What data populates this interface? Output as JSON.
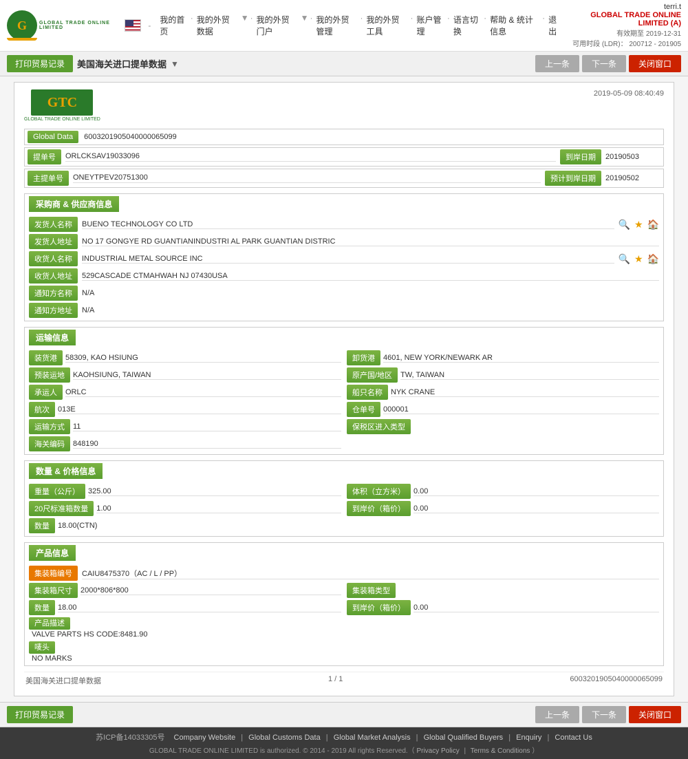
{
  "header": {
    "user": "terri.t",
    "company_name": "GLOBAL TRADE ONLINE LIMITED (A)",
    "valid_until_label": "有效期至",
    "valid_until": "2019-12-31",
    "ldr_label": "可用时段 (LDR)：",
    "ldr_value": "200712 - 201905"
  },
  "nav": {
    "home": "我的首页",
    "import_data": "我的外贸数据",
    "export_portal": "我的外贸门户",
    "foreign_mgmt": "我的外贸管理",
    "foreign_tools": "我的外贸工具",
    "account_mgmt": "账户管理",
    "language": "语言切换",
    "help": "帮助 & 统计信息",
    "logout": "退出"
  },
  "title": "美国海关进口提单数据",
  "buttons": {
    "print_trade": "打印贸易记录",
    "prev": "上一条",
    "next": "下一条",
    "close": "关闭窗口"
  },
  "doc": {
    "timestamp": "2019-05-09 08:40:49",
    "global_data_label": "Global Data",
    "global_data_value": "6003201905040000065099",
    "bill_no_label": "提单号",
    "bill_no_value": "ORLCKSAV19033096",
    "arrival_date_label": "到岸日期",
    "arrival_date_value": "20190503",
    "master_bill_label": "主提单号",
    "master_bill_value": "ONEYTPEV20751300",
    "est_arrival_label": "预计到岸日期",
    "est_arrival_value": "20190502"
  },
  "shipper_section": {
    "title": "采购商 & 供应商信息",
    "shipper_name_label": "发货人名称",
    "shipper_name_value": "BUENO TECHNOLOGY CO LTD",
    "shipper_addr_label": "发货人地址",
    "shipper_addr_value": "NO 17 GONGYE RD GUANTIANINDUSTRI AL PARK GUANTIAN DISTRIC",
    "consignee_name_label": "收货人名称",
    "consignee_name_value": "INDUSTRIAL METAL SOURCE INC",
    "consignee_addr_label": "收货人地址",
    "consignee_addr_value": "529CASCADE CTMAHWAH NJ 07430USA",
    "notify_name_label": "通知方名称",
    "notify_name_value": "N/A",
    "notify_addr_label": "通知方地址",
    "notify_addr_value": "N/A"
  },
  "transport_section": {
    "title": "运输信息",
    "loading_port_label": "装货港",
    "loading_port_value": "58309, KAO HSIUNG",
    "unloading_port_label": "卸货港",
    "unloading_port_value": "4601, NEW YORK/NEWARK AR",
    "pre_loading_label": "预装运地",
    "pre_loading_value": "KAOHSIUNG, TAIWAN",
    "origin_country_label": "原产国/地区",
    "origin_country_value": "TW, TAIWAN",
    "carrier_label": "承运人",
    "carrier_value": "ORLC",
    "vessel_label": "船只名称",
    "vessel_value": "NYK CRANE",
    "voyage_label": "航次",
    "voyage_value": "013E",
    "warehouse_label": "仓单号",
    "warehouse_value": "000001",
    "transport_mode_label": "运输方式",
    "transport_mode_value": "11",
    "bonded_zone_label": "保税区进入类型",
    "bonded_zone_value": "",
    "customs_code_label": "海关编码",
    "customs_code_value": "848190"
  },
  "quantity_section": {
    "title": "数量 & 价格信息",
    "weight_label": "重量（公斤）",
    "weight_value": "325.00",
    "volume_label": "体积（立方米）",
    "volume_value": "0.00",
    "container_20_label": "20尺标准箱数量",
    "container_20_value": "1.00",
    "arrival_price_label": "到岸价（箱价）",
    "arrival_price_value": "0.00",
    "quantity_label": "数量",
    "quantity_value": "18.00(CTN)"
  },
  "product_section": {
    "title": "产品信息",
    "container_no_label": "集装箱编号",
    "container_no_value": "CAIU8475370（AC / L / PP）",
    "container_size_label": "集装箱尺寸",
    "container_size_value": "2000*806*800",
    "container_type_label": "集装箱类型",
    "container_type_value": "",
    "quantity_label": "数量",
    "quantity_value": "18.00",
    "arrival_price_label": "到岸价（箱价）",
    "arrival_price_value": "0.00",
    "description_label": "产品描述",
    "description_value": "VALVE PARTS HS CODE:8481.90",
    "marks_label": "唛头",
    "marks_value": "NO MARKS"
  },
  "page_footer": {
    "source": "美国海关进口提单数据",
    "page": "1 / 1",
    "record_id": "6003201905040000065099"
  },
  "footer": {
    "icp": "苏ICP备14033305号",
    "links": [
      "Company Website",
      "Global Customs Data",
      "Global Market Analysis",
      "Global Qualified Buyers",
      "Enquiry",
      "Contact Us"
    ],
    "copyright": "GLOBAL TRADE ONLINE LIMITED is authorized. © 2014 - 2019 All rights Reserved.（",
    "privacy": "Privacy Policy",
    "separator": "|",
    "terms": "Terms & Conditions",
    "closing": "）"
  }
}
